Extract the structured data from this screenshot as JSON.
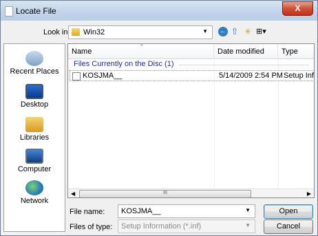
{
  "window": {
    "title": "Locate File",
    "close_label": "X"
  },
  "look_in": {
    "label": "Look in:",
    "value": "Win32"
  },
  "toolbar": {
    "back_glyph": "←",
    "up_glyph": "⇧",
    "new_folder_glyph": "✳",
    "view_glyph": "⊞▾"
  },
  "places": [
    {
      "label": "Recent Places",
      "icon": "recent-places-icon"
    },
    {
      "label": "Desktop",
      "icon": "desktop-icon"
    },
    {
      "label": "Libraries",
      "icon": "libraries-icon"
    },
    {
      "label": "Computer",
      "icon": "computer-icon"
    },
    {
      "label": "Network",
      "icon": "network-icon"
    }
  ],
  "file_list": {
    "columns": [
      "Name",
      "Date modified",
      "Type"
    ],
    "group_label": "Files Currently on the Disc (1)",
    "rows": [
      {
        "name": "KOSJMA__",
        "date": "5/14/2009 2:54 PM",
        "type": "Setup Info"
      }
    ],
    "scroll_thumb_text": "III"
  },
  "file_name": {
    "label": "File name:",
    "value": "KOSJMA__"
  },
  "file_type": {
    "label": "Files of type:",
    "value": "Setup Information (*.inf)"
  },
  "buttons": {
    "open": "Open",
    "cancel": "Cancel"
  }
}
